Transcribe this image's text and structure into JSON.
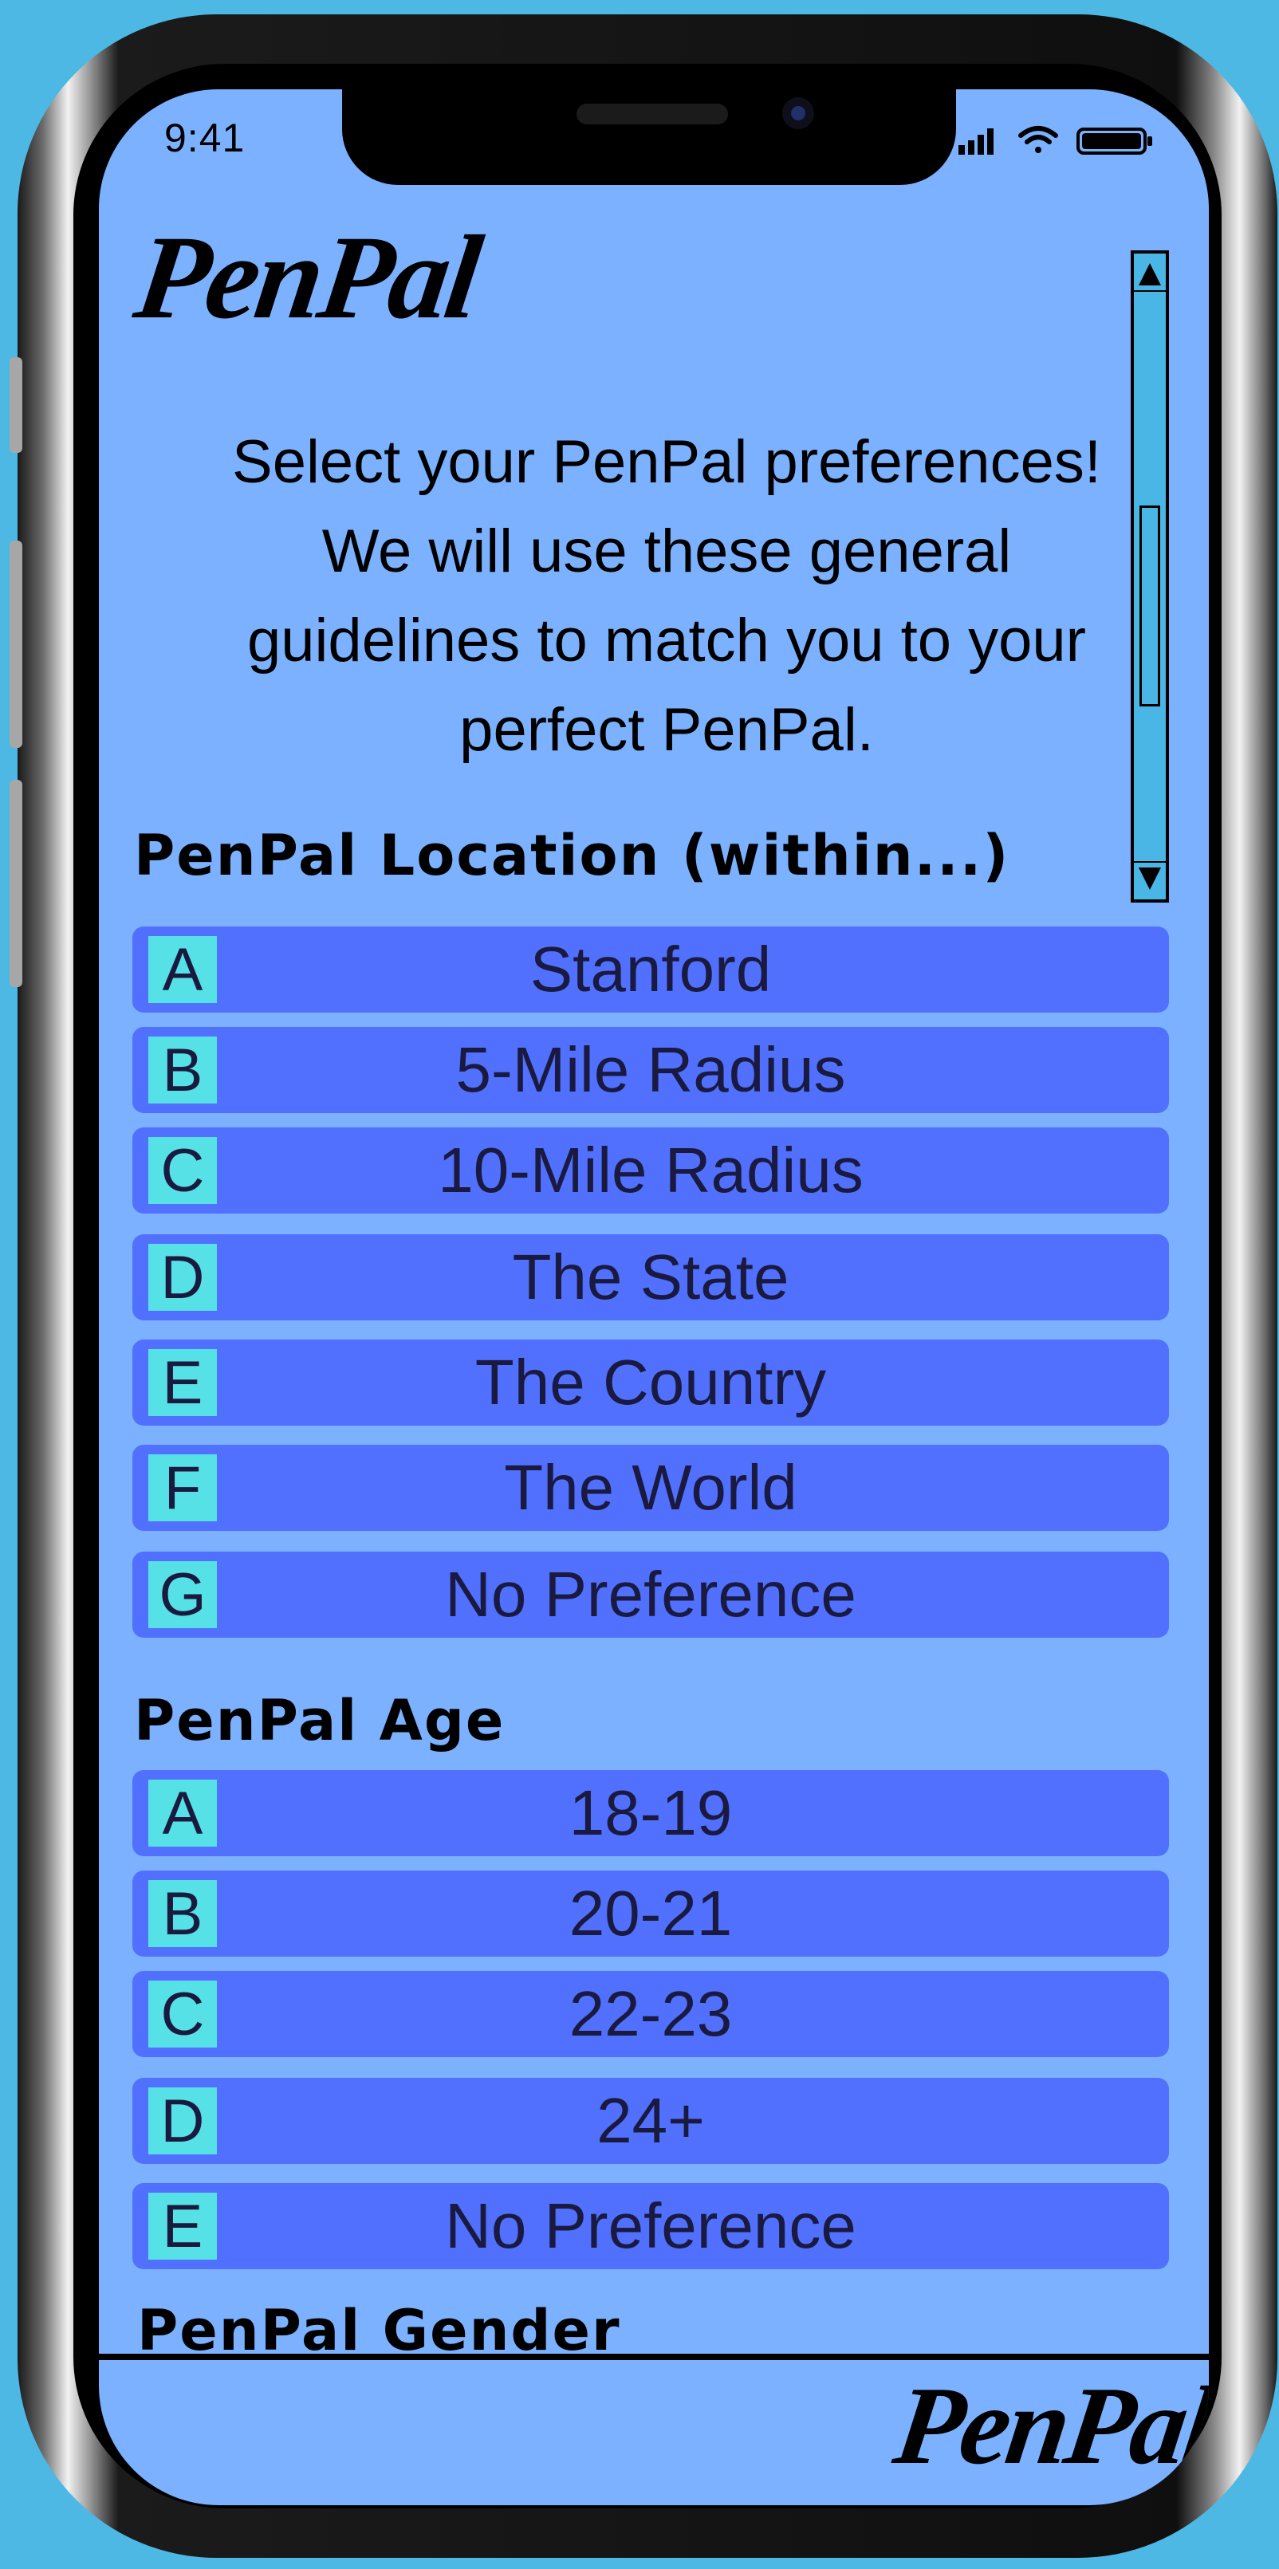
{
  "status_bar": {
    "time": "9:41"
  },
  "app": {
    "name": "PenPal"
  },
  "intro": {
    "line1": "Select your PenPal preferences!",
    "line2": "We will use these general",
    "line3": "guidelines to match you to your",
    "line4": "perfect PenPal."
  },
  "location": {
    "title": "PenPal Location (within...)",
    "options": [
      {
        "letter": "A",
        "label": "Stanford"
      },
      {
        "letter": "B",
        "label": "5-Mile Radius"
      },
      {
        "letter": "C",
        "label": "10-Mile Radius"
      },
      {
        "letter": "D",
        "label": "The State"
      },
      {
        "letter": "E",
        "label": "The Country"
      },
      {
        "letter": "F",
        "label": "The World"
      },
      {
        "letter": "G",
        "label": "No Preference"
      }
    ]
  },
  "age": {
    "title": "PenPal Age",
    "options": [
      {
        "letter": "A",
        "label": "18-19"
      },
      {
        "letter": "B",
        "label": "20-21"
      },
      {
        "letter": "C",
        "label": "22-23"
      },
      {
        "letter": "D",
        "label": "24+"
      },
      {
        "letter": "E",
        "label": "No Preference"
      }
    ]
  },
  "gender": {
    "title": "PenPal Gender"
  },
  "colors": {
    "background": "#4cb8e3",
    "screen": "#7bb1ff",
    "option_bg": "#5170fd",
    "letter_bg": "#56e1e6",
    "scrollbar": "#4ab6e6"
  },
  "icons": [
    "signal-icon",
    "wifi-icon",
    "battery-icon",
    "scroll-up-arrow-icon",
    "scroll-down-arrow-icon"
  ]
}
